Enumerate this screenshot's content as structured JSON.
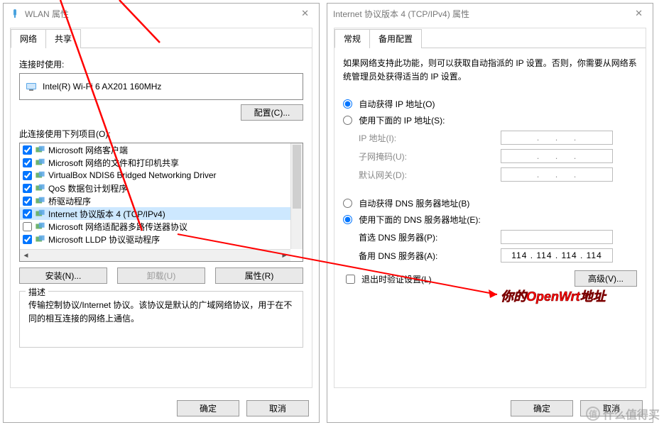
{
  "left": {
    "title": "WLAN 属性",
    "tabs": {
      "network": "网络",
      "sharing": "共享"
    },
    "connect_using": "连接时使用:",
    "adapter": "Intel(R) Wi-Fi 6 AX201 160MHz",
    "configure_btn": "配置(C)...",
    "items_label": "此连接使用下列项目(O):",
    "items": [
      {
        "checked": true,
        "label": "Microsoft 网络客户端"
      },
      {
        "checked": true,
        "label": "Microsoft 网络的文件和打印机共享"
      },
      {
        "checked": true,
        "label": "VirtualBox NDIS6 Bridged Networking Driver"
      },
      {
        "checked": true,
        "label": "QoS 数据包计划程序"
      },
      {
        "checked": true,
        "label": "桥驱动程序"
      },
      {
        "checked": true,
        "label": "Internet 协议版本 4 (TCP/IPv4)",
        "selected": true
      },
      {
        "checked": false,
        "label": "Microsoft 网络适配器多路传送器协议"
      },
      {
        "checked": true,
        "label": "Microsoft LLDP 协议驱动程序"
      }
    ],
    "install_btn": "安装(N)...",
    "uninstall_btn": "卸载(U)",
    "properties_btn": "属性(R)",
    "desc_title": "描述",
    "desc_text": "传输控制协议/Internet 协议。该协议是默认的广域网络协议，用于在不同的相互连接的网络上通信。",
    "ok": "确定",
    "cancel": "取消"
  },
  "right": {
    "title": "Internet 协议版本 4 (TCP/IPv4) 属性",
    "tabs": {
      "general": "常规",
      "alt": "备用配置"
    },
    "intro": "如果网络支持此功能，则可以获取自动指派的 IP 设置。否则，你需要从网络系统管理员处获得适当的 IP 设置。",
    "auto_ip": "自动获得 IP 地址(O)",
    "manual_ip": "使用下面的 IP 地址(S):",
    "ip_label": "IP 地址(I):",
    "mask_label": "子网掩码(U):",
    "gw_label": "默认网关(D):",
    "auto_dns": "自动获得 DNS 服务器地址(B)",
    "manual_dns": "使用下面的 DNS 服务器地址(E):",
    "pref_dns": "首选 DNS 服务器(P):",
    "alt_dns": "备用 DNS 服务器(A):",
    "alt_dns_value": "114 . 114 . 114 . 114",
    "validate": "退出时验证设置(L)",
    "advanced": "高级(V)...",
    "ok": "确定",
    "cancel": "取消"
  },
  "annotation": "你的OpenWrt地址",
  "watermark": "什么值得买"
}
